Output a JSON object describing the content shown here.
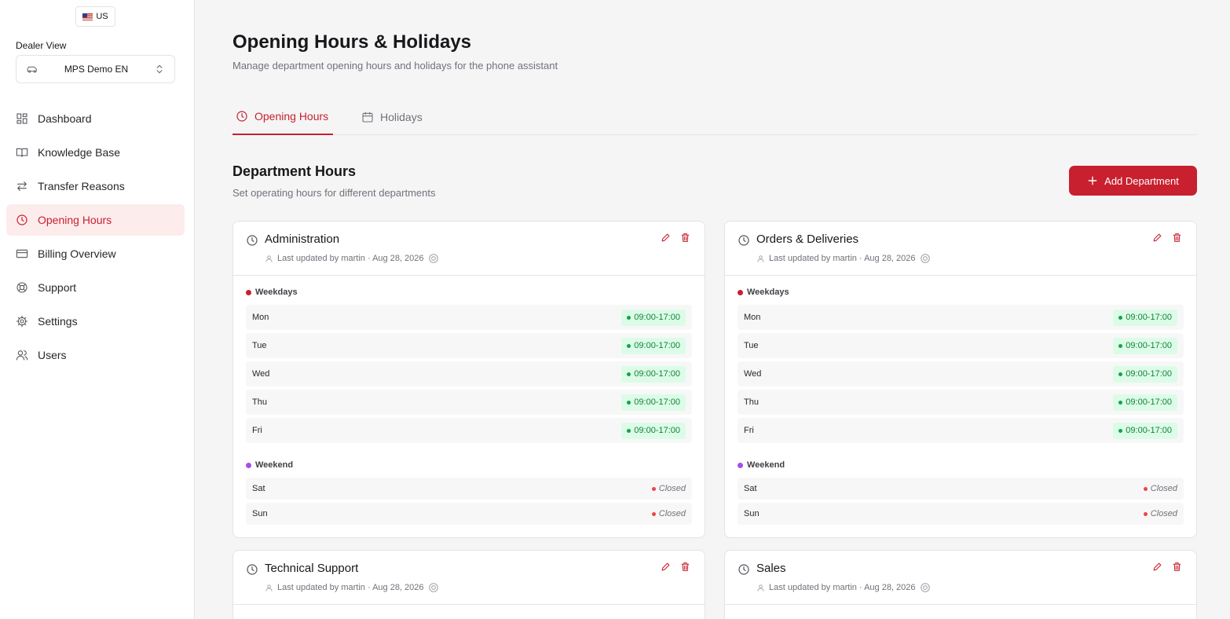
{
  "locale": {
    "label": "US"
  },
  "dealer": {
    "label": "Dealer View",
    "selected": "MPS Demo EN"
  },
  "sidebar": {
    "items": [
      {
        "label": "Dashboard",
        "icon": "dashboard-icon"
      },
      {
        "label": "Knowledge Base",
        "icon": "book-icon"
      },
      {
        "label": "Transfer Reasons",
        "icon": "arrows-icon"
      },
      {
        "label": "Opening Hours",
        "icon": "clock-icon",
        "active": true
      },
      {
        "label": "Billing Overview",
        "icon": "credit-card-icon"
      },
      {
        "label": "Support",
        "icon": "lifebuoy-icon"
      },
      {
        "label": "Settings",
        "icon": "gear-icon"
      },
      {
        "label": "Users",
        "icon": "users-icon"
      }
    ]
  },
  "header": {
    "title": "Opening Hours & Holidays",
    "subtitle": "Manage department opening hours and holidays for the phone assistant"
  },
  "tabs": [
    {
      "label": "Opening Hours",
      "active": true
    },
    {
      "label": "Holidays",
      "active": false
    }
  ],
  "section": {
    "title": "Department Hours",
    "subtitle": "Set operating hours for different departments",
    "add_label": "Add Department"
  },
  "labels": {
    "weekdays": "Weekdays",
    "weekend": "Weekend"
  },
  "departments": [
    {
      "name": "Administration",
      "meta": "Last updated by martin · Aug 28, 2026",
      "weekdays": [
        {
          "day": "Mon",
          "hours": "09:00-17:00"
        },
        {
          "day": "Tue",
          "hours": "09:00-17:00"
        },
        {
          "day": "Wed",
          "hours": "09:00-17:00"
        },
        {
          "day": "Thu",
          "hours": "09:00-17:00"
        },
        {
          "day": "Fri",
          "hours": "09:00-17:00"
        }
      ],
      "weekend": [
        {
          "day": "Sat",
          "status": "Closed"
        },
        {
          "day": "Sun",
          "status": "Closed"
        }
      ]
    },
    {
      "name": "Orders & Deliveries",
      "meta": "Last updated by martin · Aug 28, 2026",
      "weekdays": [
        {
          "day": "Mon",
          "hours": "09:00-17:00"
        },
        {
          "day": "Tue",
          "hours": "09:00-17:00"
        },
        {
          "day": "Wed",
          "hours": "09:00-17:00"
        },
        {
          "day": "Thu",
          "hours": "09:00-17:00"
        },
        {
          "day": "Fri",
          "hours": "09:00-17:00"
        }
      ],
      "weekend": [
        {
          "day": "Sat",
          "status": "Closed"
        },
        {
          "day": "Sun",
          "status": "Closed"
        }
      ]
    },
    {
      "name": "Technical Support",
      "meta": "Last updated by martin · Aug 28, 2026"
    },
    {
      "name": "Sales",
      "meta": "Last updated by martin · Aug 28, 2026"
    }
  ],
  "colors": {
    "accent": "#c8202f",
    "open": "#16a34a",
    "closed": "#ef4444",
    "weekend": "#a64ee6"
  }
}
